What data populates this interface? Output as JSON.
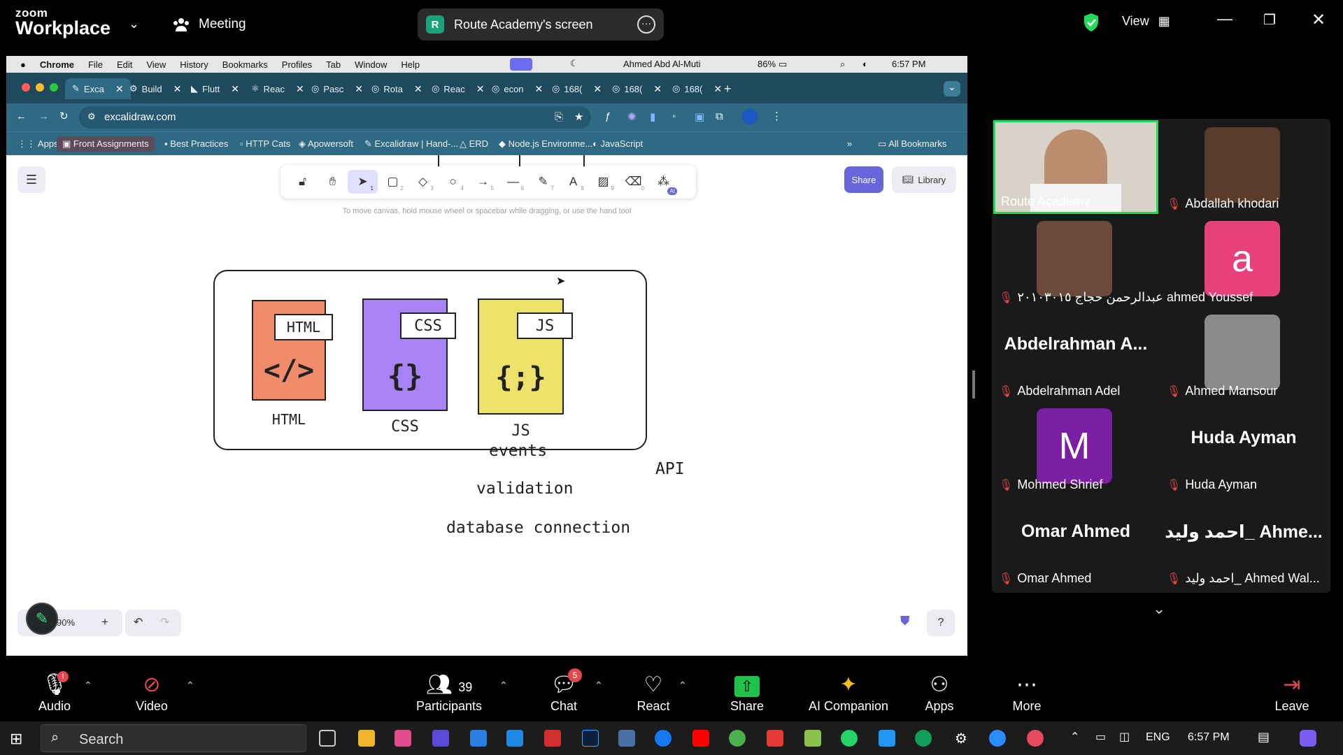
{
  "zoom": {
    "logo_line1": "zoom",
    "logo_line2": "Workplace",
    "meeting_label": "Meeting",
    "share_pill_initial": "R",
    "share_pill_label": "Route Academy's screen",
    "view_label": "View",
    "bottom": {
      "audio": "Audio",
      "video": "Video",
      "participants": "Participants",
      "participants_count": "39",
      "chat": "Chat",
      "chat_badge": "5",
      "react": "React",
      "share": "Share",
      "ai_companion": "AI Companion",
      "apps": "Apps",
      "more": "More",
      "leave": "Leave"
    }
  },
  "mac_menu": {
    "app": "Chrome",
    "items": [
      "File",
      "Edit",
      "View",
      "History",
      "Bookmarks",
      "Profiles",
      "Tab",
      "Window",
      "Help"
    ],
    "user": "Ahmed Abd Al-Muti",
    "battery": "86%",
    "time": "6:57 PM"
  },
  "browser": {
    "tabs": [
      "Exca",
      "Build",
      "Flutt",
      "Reac",
      "Pasc",
      "Rota",
      "Reac",
      "econ",
      "168(",
      "168(",
      "168("
    ],
    "url": "excalidraw.com",
    "bookmarks": [
      "Apps",
      "Front Assignments",
      "Best Practices",
      "HTTP Cats",
      "Apowersoft",
      "Excalidraw | Hand-...",
      "ERD",
      "Node.js Environme...",
      "JavaScript",
      "All Bookmarks"
    ]
  },
  "excalidraw": {
    "hint": "To move canvas, hold mouse wheel or spacebar while dragging, or use the hand tool",
    "share_btn": "Share",
    "library_btn": "Library",
    "zoom_level": "90%",
    "tool_numbers": [
      "1",
      "2",
      "3",
      "4",
      "5",
      "6",
      "7",
      "8",
      "9",
      "0"
    ],
    "ai_badge": "AI",
    "cards": [
      {
        "tag": "HTML",
        "symbol": "</>",
        "caption": "HTML",
        "color": "#f08c6b"
      },
      {
        "tag": "CSS",
        "symbol": "{}",
        "caption": "CSS",
        "color": "#a982f5"
      },
      {
        "tag": "JS",
        "symbol": "{;}",
        "caption": "JS",
        "color": "#ece26a"
      }
    ],
    "texts": {
      "events": "events",
      "validation": "validation",
      "database": "database connection",
      "api": "API"
    }
  },
  "participants": [
    {
      "name": "Route Academy",
      "muted": false,
      "active": true
    },
    {
      "name": "Abdallah khodari",
      "muted": true
    },
    {
      "name": "عبدالرحمن حجاج ٢٠١٠٣٠١٥",
      "muted": true
    },
    {
      "name": "ahmed Youssef",
      "muted": false,
      "initial": "a",
      "color": "#e8417a"
    },
    {
      "name": "Abdelrahman Adel",
      "muted": true,
      "big": "Abdelrahman  A..."
    },
    {
      "name": "Ahmed Mansour",
      "muted": true
    },
    {
      "name": "Mohmed Shrief",
      "muted": true,
      "initial": "M",
      "color": "#7b1fa2"
    },
    {
      "name": "Huda Ayman",
      "muted": true,
      "big": "Huda Ayman"
    },
    {
      "name": "Omar Ahmed",
      "muted": true,
      "big": "Omar Ahmed"
    },
    {
      "name": "احمد وليد_ Ahmed Wal...",
      "muted": true,
      "big": "احمد وليد_ Ahme..."
    }
  ],
  "taskbar": {
    "search": "Search",
    "lang": "ENG",
    "time": "6:57 PM"
  },
  "colors": {
    "active_green": "#23d959",
    "share_green": "#1fc24a",
    "excalidraw_purple": "#6965db",
    "mute_red": "#e0484b"
  }
}
